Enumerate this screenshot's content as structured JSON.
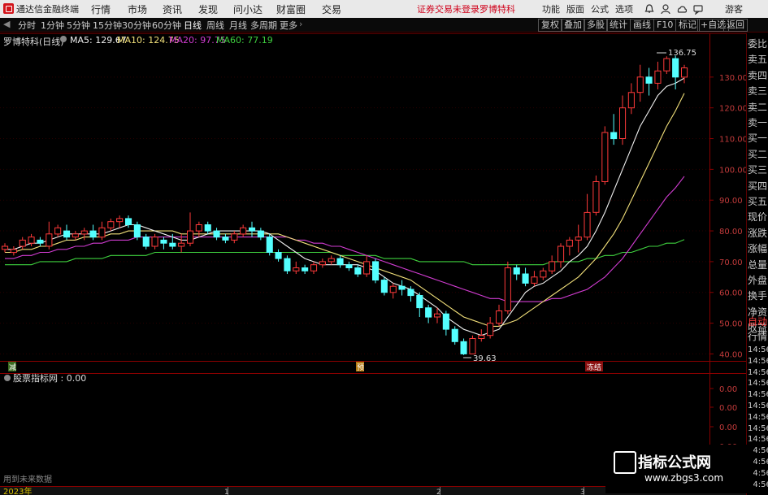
{
  "app": {
    "title": "通达信金融终端",
    "menu": [
      "行情",
      "市场",
      "资讯",
      "发现",
      "问小达",
      "财富圈",
      "交易"
    ],
    "notice": "证券交易未登录",
    "stock_name_top": "罗博特科",
    "right_menu": [
      "功能",
      "版面",
      "公式",
      "选项"
    ],
    "guest": "游客"
  },
  "toolbar": {
    "periods": [
      "分时",
      "1分钟",
      "5分钟",
      "15分钟",
      "30分钟",
      "60分钟",
      "日线",
      "周线",
      "月线",
      "多周期",
      "更多"
    ],
    "active": "日线",
    "buttons": [
      "复权",
      "叠加",
      "多股",
      "统计",
      "画线",
      "F10",
      "标记",
      "+自选",
      "返回"
    ]
  },
  "main_chart": {
    "title": "罗博特科(日线)",
    "ma": [
      {
        "label": "MA5: 129.67",
        "color": "#f0f0f0"
      },
      {
        "label": "MA10: 124.75",
        "color": "#f2e07a"
      },
      {
        "label": "MA20: 97.75",
        "color": "#d13cd1"
      },
      {
        "label": "MA60: 77.19",
        "color": "#3ecf3e"
      }
    ],
    "price_axis": [
      "130.00",
      "120.00",
      "110.00",
      "100.00",
      "90.00",
      "80.00",
      "70.00",
      "60.00",
      "50.00",
      "40.00"
    ],
    "max_label": "136.75",
    "min_label": "39.63",
    "markers": [
      "减",
      "预",
      "冻结"
    ]
  },
  "sub_chart": {
    "title": "股票指标网 : 0.00",
    "axis": [
      "0.00",
      "0.00",
      "0.00",
      "0.00",
      "0.00",
      "0.00"
    ]
  },
  "bottom": {
    "hint": "用到未来数据",
    "year": "2023年",
    "months": [
      "1",
      "2",
      "3"
    ]
  },
  "right_panel": [
    "委比",
    "卖五",
    "卖四",
    "卖三",
    "卖二",
    "卖一",
    "买一",
    "买二",
    "买三",
    "买四",
    "买五",
    "现价",
    "涨跌",
    "涨幅",
    "总量",
    "外盘",
    "换手",
    "净资",
    "收益",
    "自动",
    "行情",
    "14:56",
    "14:56",
    "14:56",
    "14:56",
    "14:56",
    "14:56",
    "14:56",
    "14:56",
    "14:56",
    "14:56",
    "14:56",
    "14:56",
    "14:56"
  ],
  "watermark": {
    "title": "指标公式网",
    "url": "www.zbgs3.com"
  },
  "chart_data": {
    "type": "candlestick",
    "ylim": [
      38,
      140
    ],
    "candles": [
      [
        74,
        75,
        73,
        76
      ],
      [
        73,
        74,
        72,
        75
      ],
      [
        75,
        77,
        74,
        78
      ],
      [
        76,
        78,
        75,
        79
      ],
      [
        77,
        76,
        75,
        78
      ],
      [
        75,
        79,
        74,
        83
      ],
      [
        79,
        81,
        78,
        82
      ],
      [
        80,
        78,
        77,
        82
      ],
      [
        78,
        79,
        77,
        80
      ],
      [
        79,
        80,
        77,
        81
      ],
      [
        80,
        78,
        77,
        82
      ],
      [
        78,
        81,
        77,
        83
      ],
      [
        81,
        83,
        80,
        84
      ],
      [
        83,
        84,
        81,
        85
      ],
      [
        84,
        82,
        81,
        85
      ],
      [
        82,
        78,
        77,
        83
      ],
      [
        78,
        75,
        74,
        79
      ],
      [
        75,
        78,
        74,
        79
      ],
      [
        77,
        76,
        74,
        78
      ],
      [
        76,
        75,
        74,
        79
      ],
      [
        75,
        76,
        73,
        79
      ],
      [
        76,
        80,
        75,
        86
      ],
      [
        80,
        82,
        78,
        83
      ],
      [
        82,
        80,
        79,
        83
      ],
      [
        80,
        78,
        77,
        81
      ],
      [
        78,
        77,
        76,
        79
      ],
      [
        77,
        79,
        76,
        80
      ],
      [
        79,
        81,
        78,
        82
      ],
      [
        81,
        80,
        78,
        83
      ],
      [
        80,
        78,
        77,
        81
      ],
      [
        78,
        73,
        72,
        79
      ],
      [
        73,
        71,
        70,
        74
      ],
      [
        71,
        67,
        66,
        72
      ],
      [
        67,
        68,
        66,
        70
      ],
      [
        68,
        67,
        66,
        69
      ],
      [
        67,
        69,
        66,
        70
      ],
      [
        69,
        70,
        68,
        71
      ],
      [
        70,
        71,
        69,
        72
      ],
      [
        71,
        69,
        68,
        72
      ],
      [
        69,
        68,
        67,
        70
      ],
      [
        68,
        66,
        65,
        69
      ],
      [
        66,
        70,
        65,
        72
      ],
      [
        70,
        64,
        63,
        71
      ],
      [
        64,
        60,
        59,
        65
      ],
      [
        60,
        62,
        58,
        63
      ],
      [
        62,
        61,
        59,
        64
      ],
      [
        61,
        59,
        57,
        62
      ],
      [
        59,
        55,
        52,
        60
      ],
      [
        55,
        52,
        50,
        56
      ],
      [
        52,
        53,
        50,
        55
      ],
      [
        53,
        48,
        46,
        54
      ],
      [
        48,
        44,
        43,
        49
      ],
      [
        44,
        40,
        39.63,
        45
      ],
      [
        40,
        45,
        40,
        46
      ],
      [
        45,
        46,
        44,
        48
      ],
      [
        46,
        50,
        45,
        52
      ],
      [
        50,
        54,
        49,
        56
      ],
      [
        54,
        68,
        53,
        70
      ],
      [
        68,
        66,
        64,
        69
      ],
      [
        66,
        63,
        62,
        68
      ],
      [
        63,
        65,
        62,
        67
      ],
      [
        65,
        67,
        64,
        68
      ],
      [
        67,
        70,
        66,
        72
      ],
      [
        70,
        75,
        68,
        76
      ],
      [
        75,
        77,
        72,
        78
      ],
      [
        77,
        78,
        73,
        82
      ],
      [
        78,
        86,
        77,
        92
      ],
      [
        86,
        96,
        85,
        98
      ],
      [
        96,
        112,
        95,
        114
      ],
      [
        112,
        110,
        108,
        118
      ],
      [
        110,
        120,
        108,
        124
      ],
      [
        120,
        125,
        118,
        128
      ],
      [
        125,
        130,
        122,
        134
      ],
      [
        130,
        128,
        124,
        133
      ],
      [
        128,
        132,
        126,
        135
      ],
      [
        132,
        136,
        131,
        136.75
      ],
      [
        136,
        130,
        126,
        137
      ],
      [
        130,
        133,
        128,
        134
      ]
    ],
    "ma5": [
      74,
      74,
      75,
      76,
      76,
      77,
      78,
      79,
      79,
      79,
      79,
      79,
      80,
      81,
      82,
      82,
      81,
      80,
      79,
      78,
      77,
      77,
      78,
      79,
      80,
      80,
      80,
      80,
      80,
      80,
      79,
      77,
      75,
      73,
      71,
      70,
      69,
      69,
      69,
      69,
      69,
      68,
      67,
      65,
      63,
      62,
      61,
      59,
      57,
      55,
      52,
      50,
      48,
      47,
      46,
      47,
      48,
      52,
      56,
      60,
      62,
      63,
      65,
      67,
      70,
      72,
      75,
      80,
      86,
      93,
      100,
      107,
      114,
      119,
      124,
      127,
      128,
      129.67
    ],
    "ma10": [
      73,
      73,
      74,
      74,
      75,
      75,
      76,
      77,
      77,
      78,
      78,
      78,
      79,
      79,
      80,
      80,
      80,
      80,
      80,
      80,
      79,
      79,
      79,
      79,
      79,
      79,
      79,
      79,
      79,
      79,
      79,
      79,
      78,
      77,
      76,
      75,
      74,
      73,
      72,
      71,
      70,
      69,
      68,
      67,
      66,
      65,
      64,
      62,
      60,
      58,
      56,
      54,
      52,
      51,
      50,
      49,
      49,
      50,
      51,
      53,
      55,
      57,
      59,
      61,
      63,
      65,
      68,
      71,
      75,
      79,
      84,
      90,
      96,
      102,
      108,
      114,
      119,
      124.75
    ],
    "ma20": [
      71,
      71,
      72,
      72,
      73,
      73,
      74,
      74,
      75,
      75,
      76,
      76,
      77,
      77,
      77,
      78,
      78,
      78,
      78,
      78,
      78,
      78,
      78,
      78,
      78,
      78,
      78,
      78,
      78,
      78,
      78,
      78,
      78,
      77,
      77,
      76,
      76,
      75,
      75,
      74,
      73,
      72,
      71,
      70,
      69,
      68,
      67,
      66,
      65,
      64,
      63,
      62,
      61,
      60,
      59,
      58,
      58,
      57,
      57,
      57,
      57,
      57,
      58,
      58,
      59,
      60,
      61,
      63,
      65,
      68,
      71,
      75,
      79,
      83,
      87,
      91,
      94,
      97.75
    ],
    "ma60": [
      69,
      69,
      69,
      69,
      70,
      70,
      70,
      70,
      71,
      71,
      71,
      71,
      72,
      72,
      72,
      72,
      72,
      73,
      73,
      73,
      73,
      73,
      73,
      73,
      73,
      73,
      73,
      73,
      73,
      73,
      73,
      73,
      73,
      73,
      73,
      73,
      73,
      73,
      72,
      72,
      72,
      72,
      72,
      71,
      71,
      71,
      71,
      70,
      70,
      70,
      70,
      70,
      70,
      69,
      69,
      69,
      69,
      69,
      69,
      69,
      69,
      69,
      70,
      70,
      70,
      70,
      71,
      71,
      72,
      72,
      73,
      73,
      74,
      75,
      75,
      76,
      76,
      77.19
    ]
  }
}
